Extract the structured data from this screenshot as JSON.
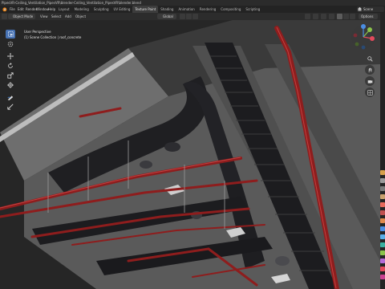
{
  "window": {
    "title": "PipesVR-Ceiling_Ventilation_PipesVR\\blender-Ceiling_Ventilation_PipesVR\\blender.blend"
  },
  "topbar": {
    "menus": [
      "File",
      "Edit",
      "Render",
      "Window",
      "Help"
    ],
    "workspaces": [
      "Layout",
      "Modeling",
      "Sculpting",
      "UV Editing",
      "Texture Paint",
      "Shading",
      "Animation",
      "Rendering",
      "Compositing",
      "Scripting"
    ],
    "active_workspace": "Texture Paint",
    "scene": "Scene"
  },
  "viewport_header": {
    "mode": "Object Mode",
    "menus": [
      "View",
      "Select",
      "Add",
      "Object"
    ],
    "pivot": "Global",
    "options_label": "Options"
  },
  "viewport": {
    "view_name": "User Perspective",
    "collection_info": "(1) Scene Collection | roof_concrete"
  },
  "icons": {
    "toolbar": [
      "select-box-icon",
      "cursor-icon",
      "move-icon",
      "rotate-icon",
      "scale-icon",
      "transform-icon",
      "annotate-icon",
      "measure-icon"
    ],
    "nav": [
      "zoom-icon",
      "pan-icon",
      "camera-view-icon",
      "perspective-icon"
    ]
  },
  "colors": {
    "accent": "#4772b3",
    "gizmo_x": "#e34a5c",
    "gizmo_y": "#8bc34a",
    "gizmo_z": "#4b8de3",
    "pipes": "#8e1d1d",
    "ducts": "#1f1f22",
    "concrete": "#5a5a5a"
  }
}
